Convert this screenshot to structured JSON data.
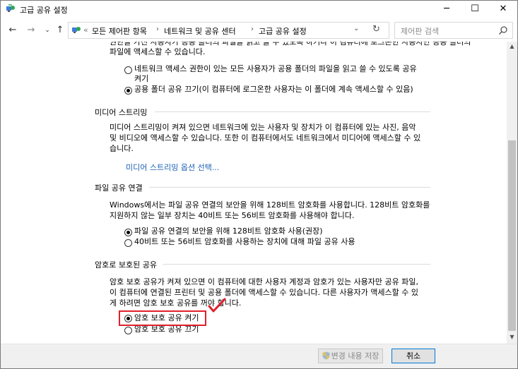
{
  "window": {
    "title": "고급 공유 설정",
    "minimize": "─",
    "maximize": "☐",
    "close": "✕"
  },
  "nav": {
    "back": "←",
    "forward": "→",
    "recent": "⌄",
    "up": "↑",
    "prefix": "«",
    "breadcrumbs": [
      "모든 제어판 항목",
      "네트워크 및 공유 센터",
      "고급 공유 설정"
    ],
    "separator": "›",
    "dropdown": "⌄",
    "refresh": "↻",
    "search_placeholder": "제어판 검색"
  },
  "content": {
    "top_partial_line": "권한을 가진 사용자가 공용 폴더의 파일을 읽고 쓸 수 있도록 하거나 이 컴퓨터에 로그온한 사용자만 공용 폴더의",
    "top_line2": "파일에 액세스할 수 있습니다.",
    "public_folder": {
      "option_on_line1": "네트워크 액세스 권한이 있는 모든 사용자가 공용 폴더의 파일을 읽고 쓸 수 있도록 공유",
      "option_on_line2": "켜기",
      "option_off": "공용 폴더 공유 끄기(이 컴퓨터에 로그온한 사용자는 이 폴더에 계속 액세스할 수 있음)",
      "selected": "off"
    },
    "media": {
      "heading": "미디어 스트리밍",
      "desc_line1": "미디어 스트리밍이 켜져 있으면 네트워크에 있는 사용자 및 장치가 이 컴퓨터에 있는 사진, 음악",
      "desc_line2": "및 비디오에 액세스할 수 있습니다. 또한 이 컴퓨터에서도 네트워크에서 미디어에 액세스할 수 있",
      "desc_line3": "습니다.",
      "link": "미디어 스트리밍 옵션 선택..."
    },
    "file_sharing": {
      "heading": "파일 공유 연결",
      "desc_line1": "Windows에서는 파일 공유 연결의 보안을 위해 128비트 암호화를 사용합니다. 128비트 암호화를",
      "desc_line2": "지원하지 않는 일부 장치는 40비트 또는 56비트 암호화를 사용해야 합니다.",
      "option_128": "파일 공유 연결의 보안을 위해 128비트 암호화 사용(권장)",
      "option_40": "40비트 또는 56비트 암호화를 사용하는 장치에 대해 파일 공유 사용",
      "selected": "128"
    },
    "password": {
      "heading": "암호로 보호된 공유",
      "desc_line1": "암호 보호 공유가 켜져 있으면 이 컴퓨터에 대한 사용자 계정과 암호가 있는 사용자만 공유 파일,",
      "desc_line2": "이 컴퓨터에 연결된 프린터 및 공용 폴더에 액세스할 수 있습니다. 다른 사용자가 액세스할 수 있",
      "desc_line3": "게 하려면 암호 보호 공유를 꺼야 합니다.",
      "option_on": "암호 보호 공유 켜기",
      "option_off": "암호 보호 공유 끄기",
      "selected": "on"
    }
  },
  "scrollbar": {
    "up": "▲",
    "down": "▼"
  },
  "footer": {
    "save_label": "변경 내용 저장",
    "cancel_label": "취소"
  },
  "colors": {
    "highlight": "#e0202b",
    "link": "#1a5fb4",
    "accent": "#0078d7"
  }
}
